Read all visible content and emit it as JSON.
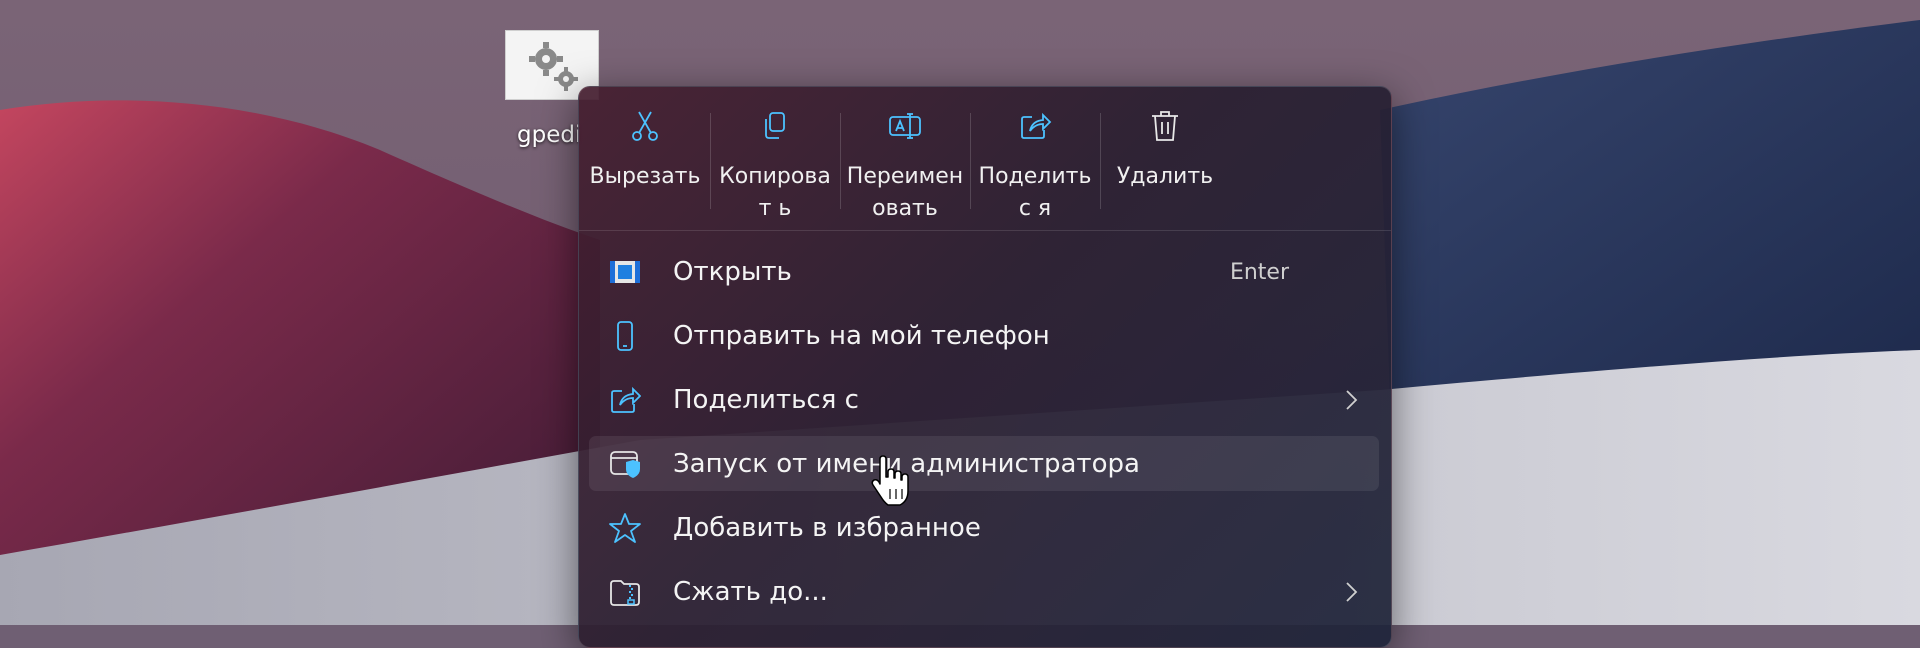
{
  "desktop": {
    "icon": {
      "name": "gpedi",
      "icon_name": "gears-icon"
    }
  },
  "context_menu": {
    "toolbar": [
      {
        "label": "Вырезать",
        "icon": "scissors-icon"
      },
      {
        "label": "Копироват ь",
        "icon": "copy-icon"
      },
      {
        "label": "Переимен овать",
        "icon": "rename-icon"
      },
      {
        "label": "Поделитьс я",
        "icon": "share-icon"
      },
      {
        "label": "Удалить",
        "icon": "trash-icon"
      }
    ],
    "items": [
      {
        "label": "Открыть",
        "shortcut": "Enter",
        "icon": "open-app-icon"
      },
      {
        "label": "Отправить на мой телефон",
        "icon": "phone-icon"
      },
      {
        "label": "Поделиться с",
        "icon": "share-icon",
        "submenu": true
      },
      {
        "label": "Запуск от имени администратора",
        "icon": "shield-window-icon",
        "hovered": true
      },
      {
        "label": "Добавить в избранное",
        "icon": "star-icon"
      },
      {
        "label": "Сжать до...",
        "icon": "zip-folder-icon",
        "submenu": true
      }
    ]
  },
  "colors": {
    "accent": "#4cc2ff",
    "menu_text": "#f4f4f4"
  }
}
